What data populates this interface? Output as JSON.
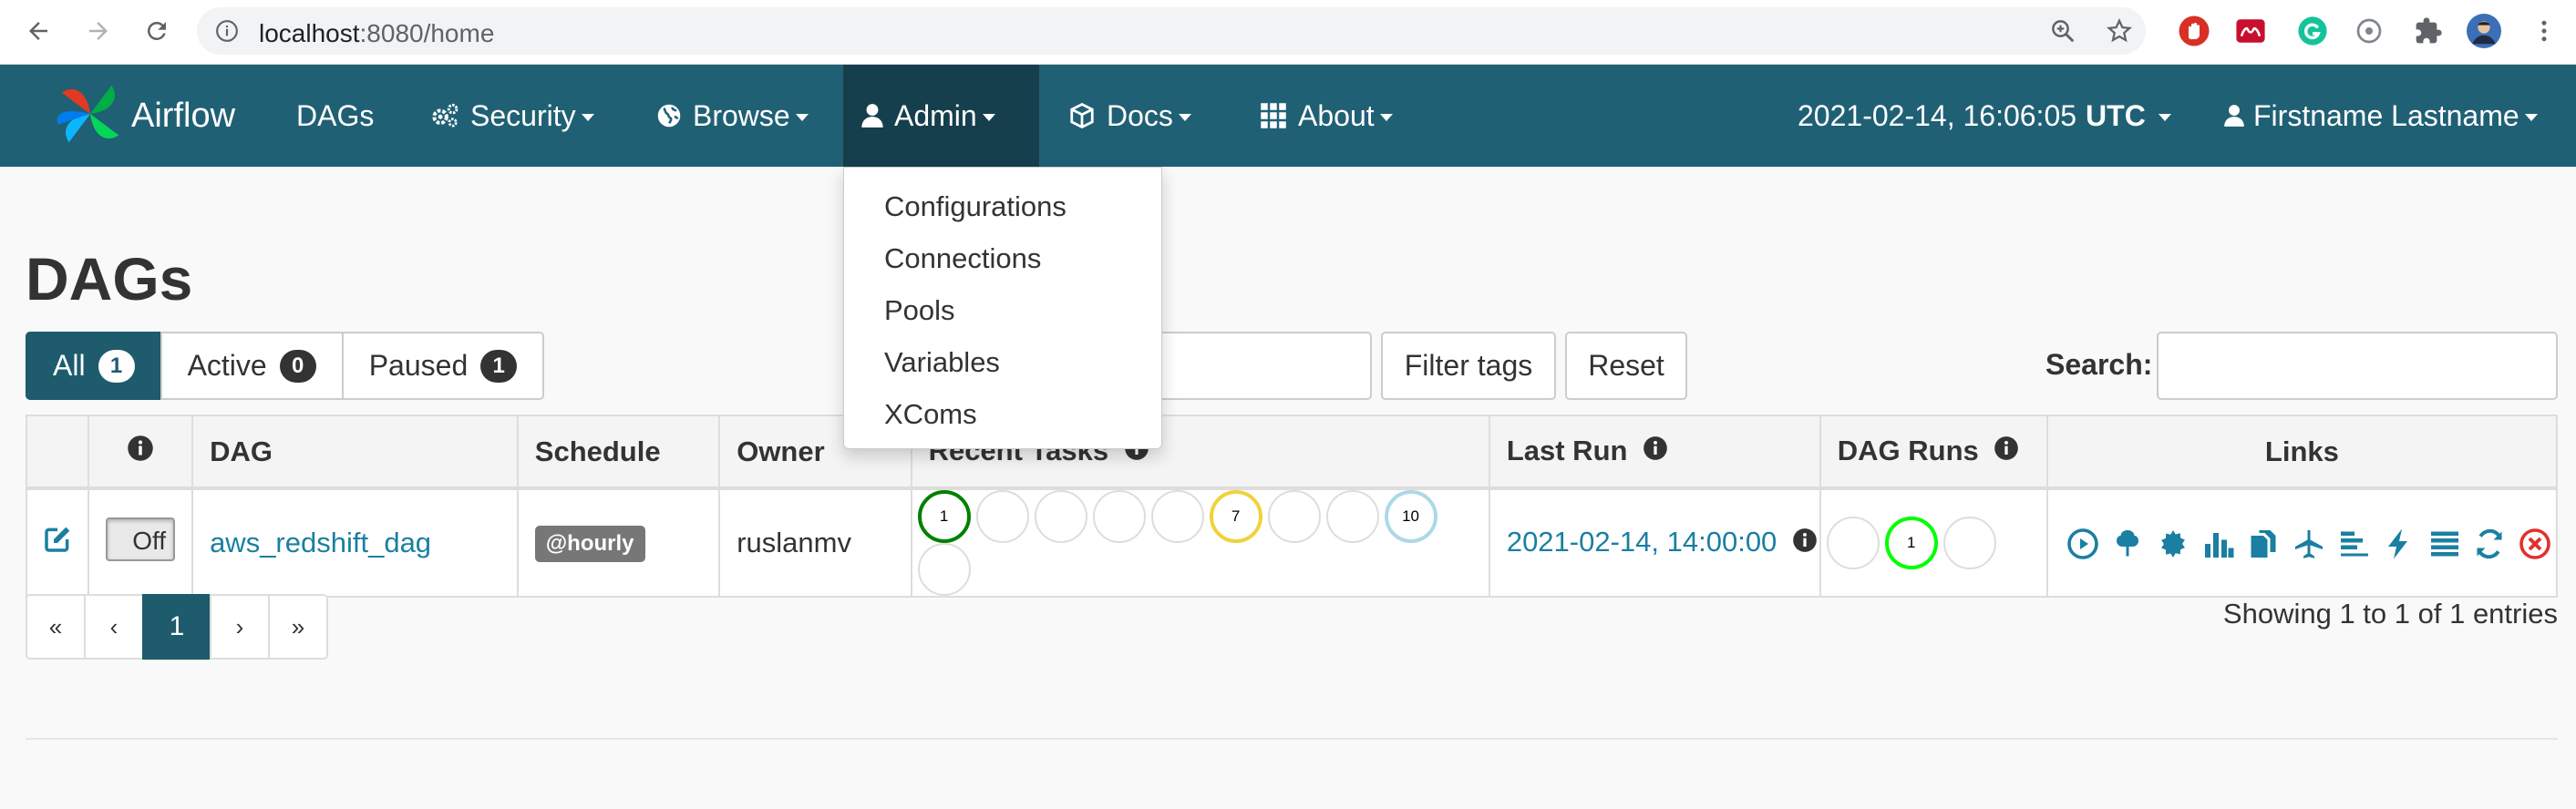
{
  "browser": {
    "url_host": "localhost",
    "url_rest": ":8080/home"
  },
  "navbar": {
    "brand": "Airflow",
    "items": [
      {
        "label": "DAGs"
      },
      {
        "label": "Security"
      },
      {
        "label": "Browse"
      },
      {
        "label": "Admin"
      },
      {
        "label": "Docs"
      },
      {
        "label": "About"
      }
    ],
    "datetime": "2021-02-14, 16:06:05",
    "timezone": "UTC",
    "user": "Firstname Lastname"
  },
  "admin_dropdown": {
    "items": [
      "Configurations",
      "Connections",
      "Pools",
      "Variables",
      "XComs"
    ]
  },
  "page": {
    "title": "DAGs",
    "filters": [
      {
        "label": "All",
        "count": "1"
      },
      {
        "label": "Active",
        "count": "0"
      },
      {
        "label": "Paused",
        "count": "1"
      }
    ],
    "filter_tags_label": "Filter tags",
    "reset_label": "Reset",
    "search_label": "Search:"
  },
  "table": {
    "headers": {
      "dag": "DAG",
      "schedule": "Schedule",
      "owner": "Owner",
      "recent_tasks": "Recent Tasks",
      "last_run": "Last Run",
      "dag_runs": "DAG Runs",
      "links": "Links"
    },
    "rows": [
      {
        "toggle": "Off",
        "dag_id": "aws_redshift_dag",
        "schedule": "@hourly",
        "owner": "ruslanmv",
        "recent_tasks": [
          "1",
          "",
          "",
          "",
          "",
          "7",
          "",
          "",
          "10",
          ""
        ],
        "last_run": "2021-02-14, 14:00:00",
        "dag_runs": [
          "",
          "1",
          ""
        ]
      }
    ]
  },
  "pagination": {
    "first": "«",
    "prev": "‹",
    "current": "1",
    "next": "›",
    "last": "»"
  },
  "showing": "Showing 1 to 1 of 1 entries",
  "colors": {
    "navbar": "#206074",
    "active": "#1d5b6d",
    "link": "#1a7fa2",
    "success": "#008000",
    "queued": "#f0d23c",
    "scheduled": "#add8e6",
    "running": "#00ff00"
  }
}
